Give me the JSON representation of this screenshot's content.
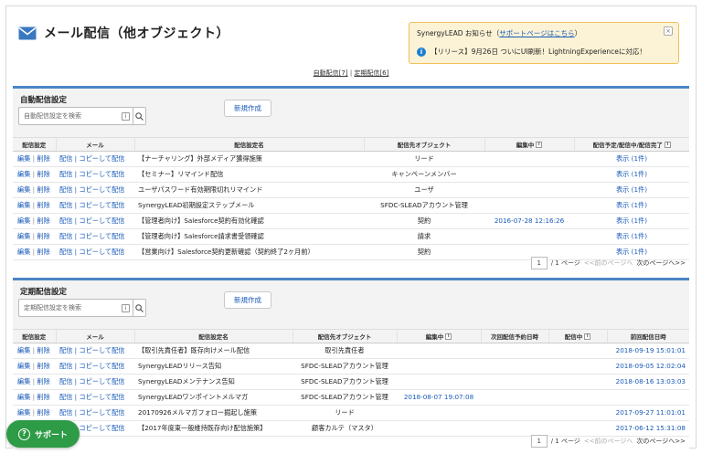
{
  "page": {
    "title": "メール配信（他オブジェクト）"
  },
  "notice": {
    "prefix": "SynergyLEAD お知らせ（",
    "link": "サポートページはこちら",
    "suffix": "）",
    "close": "×",
    "message": "【リリース】9月26日 ついにUI刷新！LightningExperienceに対応！"
  },
  "quick_links": {
    "auto": "自動配信[7]",
    "divider": "|",
    "scheduled": "定期配信[6]"
  },
  "auto_section": {
    "title": "自動配信設定",
    "search_placeholder": "自動配信設定を検索",
    "new_button": "新規作成",
    "headers": [
      "配信設定",
      "メール",
      "配信設定名",
      "配信先オブジェクト",
      "編集中",
      "配信予定/配信中/配信完了"
    ],
    "rows": [
      {
        "edit": "編集",
        "delete": "削除",
        "send": "配信",
        "copy": "コピーして配信",
        "name": "【ナーチャリング】外部メディア獲得施策",
        "object": "リード",
        "editing": "",
        "status": "表示 (1件)"
      },
      {
        "edit": "編集",
        "delete": "削除",
        "send": "配信",
        "copy": "コピーして配信",
        "name": "【セミナー】リマインド配信",
        "object": "キャンペーンメンバー",
        "editing": "",
        "status": "表示 (1件)"
      },
      {
        "edit": "編集",
        "delete": "削除",
        "send": "配信",
        "copy": "コピーして配信",
        "name": "ユーザパスワード有効期限切れリマインド",
        "object": "ユーザ",
        "editing": "",
        "status": "表示 (1件)"
      },
      {
        "edit": "編集",
        "delete": "削除",
        "send": "配信",
        "copy": "コピーして配信",
        "name": "SynergyLEAD初期設定ステップメール",
        "object": "SFDC-SLEADアカウント管理",
        "editing": "",
        "status": "表示 (1件)"
      },
      {
        "edit": "編集",
        "delete": "削除",
        "send": "配信",
        "copy": "コピーして配信",
        "name": "【管理者向け】Salesforce契約有効化確認",
        "object": "契約",
        "editing": "2016-07-28 12:16:26",
        "status": "表示 (1件)"
      },
      {
        "edit": "編集",
        "delete": "削除",
        "send": "配信",
        "copy": "コピーして配信",
        "name": "【管理者向け】Salesforce請求書受領確認",
        "object": "請求",
        "editing": "",
        "status": "表示 (1件)"
      },
      {
        "edit": "編集",
        "delete": "削除",
        "send": "配信",
        "copy": "コピーして配信",
        "name": "【営業向け】Salesforce契約更新確認（契約終了2ヶ月前）",
        "object": "契約",
        "editing": "",
        "status": "表示 (1件)"
      }
    ],
    "pager": {
      "page": "1",
      "of": "/ 1 ページ",
      "prev": "<<前のページへ",
      "next": "次のページへ>>"
    }
  },
  "scheduled_section": {
    "title": "定期配信設定",
    "search_placeholder": "定期配信設定を検索",
    "new_button": "新規作成",
    "headers": [
      "配信設定",
      "メール",
      "配信設定名",
      "配信先オブジェクト",
      "編集中",
      "次回配信予約日時",
      "配信中",
      "前回配信日時"
    ],
    "rows": [
      {
        "edit": "編集",
        "delete": "削除",
        "send": "配信",
        "copy": "コピーして配信",
        "name": "【取引先責任者】既存向けメール配信",
        "object": "取引先責任者",
        "editing": "",
        "next": "",
        "sending": "",
        "last": "2018-09-19 15:01:01"
      },
      {
        "edit": "編集",
        "delete": "削除",
        "send": "配信",
        "copy": "コピーして配信",
        "name": "SynergyLEADリリース告知",
        "object": "SFDC-SLEADアカウント管理",
        "editing": "",
        "next": "",
        "sending": "",
        "last": "2018-09-05 12:02:04"
      },
      {
        "edit": "編集",
        "delete": "削除",
        "send": "配信",
        "copy": "コピーして配信",
        "name": "SynergyLEADメンテナンス告知",
        "object": "SFDC-SLEADアカウント管理",
        "editing": "",
        "next": "",
        "sending": "",
        "last": "2018-08-16 13:03:03"
      },
      {
        "edit": "編集",
        "delete": "削除",
        "send": "配信",
        "copy": "コピーして配信",
        "name": "SynergyLEADワンポイントメルマガ",
        "object": "SFDC-SLEADアカウント管理",
        "editing": "2018-08-07 19:07:08",
        "next": "",
        "sending": "",
        "last": ""
      },
      {
        "edit": "編集",
        "delete": "削除",
        "send": "配信",
        "copy": "コピーして配信",
        "name": "20170926メルマガフォロー掘起し施策",
        "object": "リード",
        "editing": "",
        "next": "",
        "sending": "",
        "last": "2017-09-27 11:01:01"
      },
      {
        "edit": "編集",
        "delete": "削除",
        "send": "配信",
        "copy": "コピーして配信",
        "name": "【2017年度東一般維持既存向け配信施策】",
        "object": "顧客カルテ（マスタ）",
        "editing": "",
        "next": "",
        "sending": "",
        "last": "2017-06-12 15:31:08"
      }
    ],
    "pager": {
      "page": "1",
      "of": "/ 1 ページ",
      "prev": "<<前のページへ",
      "next": "次のページへ>>"
    }
  },
  "support": {
    "label": "サポート"
  },
  "colors": {
    "accent": "#4a86c5",
    "link": "#1a5bb8",
    "notice_bg": "#fcf3d6",
    "notice_border": "#f0c05a",
    "support": "#2e9b46"
  }
}
